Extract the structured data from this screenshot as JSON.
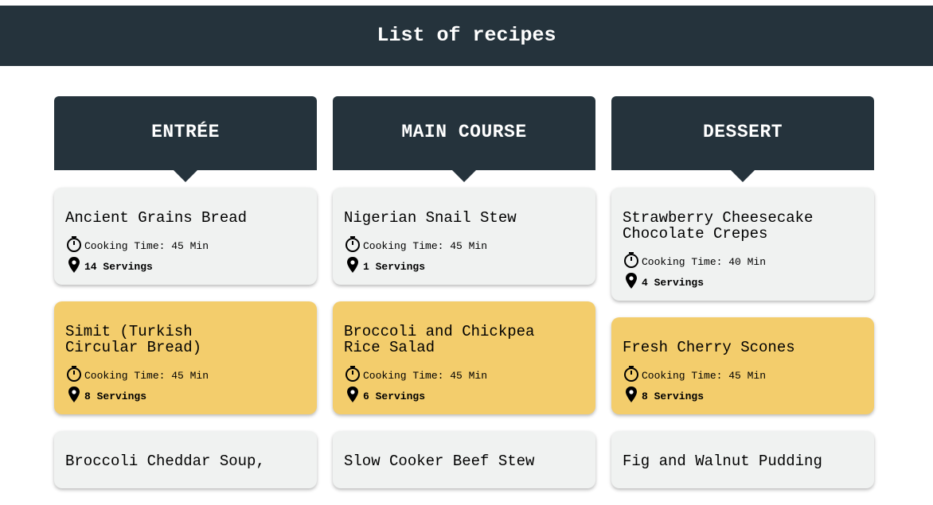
{
  "page": {
    "title": "List of recipes"
  },
  "labels": {
    "cooking_time_prefix": "Cooking Time: ",
    "servings_suffix": " Servings"
  },
  "colors": {
    "header_bg": "#25333c",
    "card_light": "#f0f2f1",
    "card_gold": "#f3cd6c"
  },
  "columns": [
    {
      "heading": "ENTRÉE",
      "recipes": [
        {
          "title": "Ancient Grains Bread",
          "time": "Cooking Time: 45 Min",
          "servings": "14 Servings",
          "style": "light"
        },
        {
          "title": "Simit (Turkish\nCircular Bread)",
          "time": "Cooking Time: 45 Min",
          "servings": "8 Servings",
          "style": "gold"
        },
        {
          "title": "Broccoli Cheddar Soup,",
          "time": "",
          "servings": "",
          "style": "light"
        }
      ]
    },
    {
      "heading": "MAIN COURSE",
      "recipes": [
        {
          "title": "Nigerian Snail Stew",
          "time": "Cooking Time: 45 Min",
          "servings": "1 Servings",
          "style": "light"
        },
        {
          "title": "Broccoli and Chickpea\nRice Salad",
          "time": "Cooking Time: 45 Min",
          "servings": "6 Servings",
          "style": "gold"
        },
        {
          "title": "Slow Cooker Beef Stew",
          "time": "",
          "servings": "",
          "style": "light"
        }
      ]
    },
    {
      "heading": "DESSERT",
      "recipes": [
        {
          "title": "Strawberry Cheesecake\nChocolate Crepes",
          "time": "Cooking Time: 40 Min",
          "servings": "4 Servings",
          "style": "light"
        },
        {
          "title": "Fresh Cherry Scones",
          "time": "Cooking Time: 45 Min",
          "servings": "8 Servings",
          "style": "gold"
        },
        {
          "title": "Fig and Walnut Pudding",
          "time": "",
          "servings": "",
          "style": "light"
        }
      ]
    }
  ],
  "icons": {
    "time": "stopwatch-icon",
    "servings": "location-pin-icon"
  }
}
